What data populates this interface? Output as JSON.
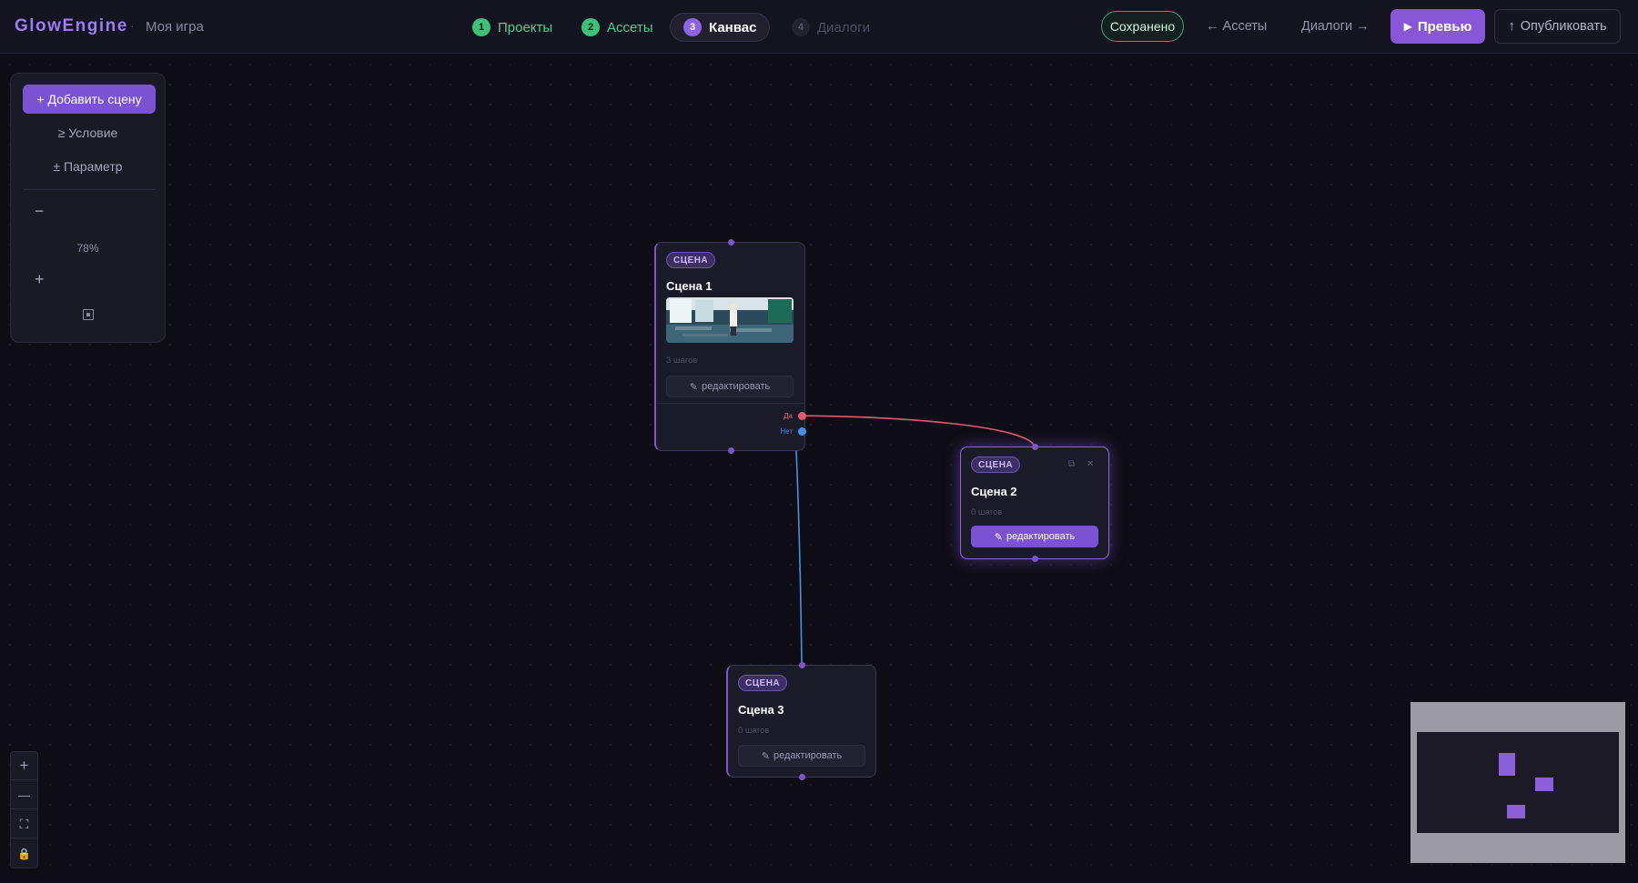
{
  "app": {
    "brand": "GlowEngine",
    "separator": "·",
    "project_name": "Моя игра"
  },
  "steps": [
    {
      "num": "1",
      "label": "Проекты",
      "state": "done"
    },
    {
      "num": "2",
      "label": "Ассеты",
      "state": "done"
    },
    {
      "num": "3",
      "label": "Канвас",
      "state": "active"
    },
    {
      "num": "4",
      "label": "Диалоги",
      "state": "disabled"
    }
  ],
  "header_actions": {
    "saved_label": "Сохранено",
    "back_label": "← Ассеты",
    "next_label": "Диалоги →",
    "preview_icon": "▶",
    "preview_label": "Превью",
    "publish_icon": "↑",
    "publish_label": "Опубликовать"
  },
  "toolpanel": {
    "add_scene_label": "+ Добавить сцену",
    "condition_label": "≥ Условие",
    "parameter_label": "± Параметр",
    "zoom_minus": "−",
    "zoom_level": "78%",
    "zoom_plus": "+"
  },
  "nodes": [
    {
      "id": "scene-1",
      "badge": "СЦЕНА",
      "title": "Сцена 1",
      "steps": "3 шагов",
      "edit_label": "редактировать",
      "edit_icon": "✎",
      "outputs": [
        {
          "label": "Да",
          "color": "#e05a73"
        },
        {
          "label": "Нет",
          "color": "#4a8fe0"
        }
      ]
    },
    {
      "id": "scene-2",
      "badge": "СЦЕНА",
      "title": "Сцена 2",
      "steps": "0 шагов",
      "edit_label": "редактировать",
      "edit_icon": "✎",
      "copy_icon": "⧉",
      "close_icon": "✕"
    },
    {
      "id": "scene-3",
      "badge": "СЦЕНА",
      "title": "Сцена 3",
      "steps": "0 шагов",
      "edit_label": "редактировать",
      "edit_icon": "✎"
    }
  ],
  "controls": {
    "zoom_in": "+",
    "zoom_out": "—",
    "fit": "⛶",
    "lock": "🔒"
  },
  "colors": {
    "accent": "#8757d8",
    "edge_yes": "#e05a73",
    "edge_no": "#4a8fe0",
    "success": "#3fbf78"
  }
}
